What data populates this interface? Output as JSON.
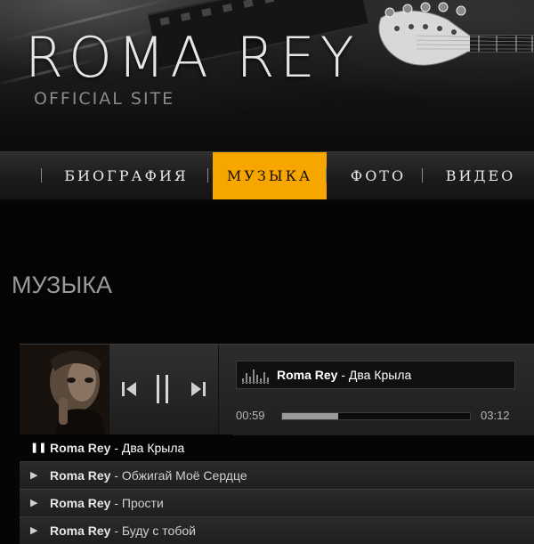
{
  "site": {
    "title": "ROMA REY",
    "subtitle": "OFFICIAL SITE"
  },
  "nav": {
    "items": [
      {
        "label": "БИОГРАФИЯ"
      },
      {
        "label": "МУЗЫКА",
        "active": true
      },
      {
        "label": "ФОТО"
      },
      {
        "label": "ВИДЕО"
      }
    ]
  },
  "page": {
    "title": "МУЗЫКА"
  },
  "player": {
    "now_playing": {
      "artist": "Roma Rey",
      "separator": " - ",
      "title": "Два Крыла"
    },
    "current_time": "00:59",
    "total_time": "03:12",
    "progress": 0.3,
    "icons": {
      "prev": "previous-icon",
      "pause": "pause-icon",
      "next": "next-icon",
      "equalizer": "equalizer-icon"
    }
  },
  "playlist": [
    {
      "icon": "pause-icon",
      "glyph": "❚❚",
      "artist": "Roma Rey",
      "separator": " - ",
      "title": "Два Крыла",
      "current": true
    },
    {
      "icon": "play-icon",
      "glyph": "▶",
      "artist": "Roma Rey",
      "separator": " - ",
      "title": "Обжигай Моё Сердце"
    },
    {
      "icon": "play-icon",
      "glyph": "▶",
      "artist": "Roma Rey",
      "separator": " - ",
      "title": "Прости"
    },
    {
      "icon": "play-icon",
      "glyph": "▶",
      "artist": "Roma Rey",
      "separator": " - ",
      "title": "Буду с тобой"
    }
  ],
  "colors": {
    "accent": "#f7a600",
    "background": "#050505"
  }
}
